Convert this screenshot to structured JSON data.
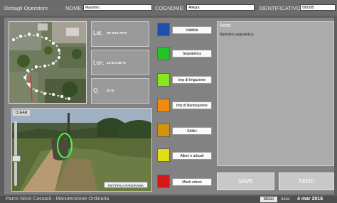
{
  "header": {
    "title": "Dettagli Operatore",
    "nome_label": "NOME:",
    "nome_value": "Massimo",
    "cognome_label": "COGNOME:",
    "cognome_value": "Allegra",
    "id_label": "IDENTIFICATIVO:",
    "id_value": "590395"
  },
  "coordinates": {
    "lat_label": "Lat.",
    "lat_value": "38° 8'57.79\"N",
    "lon_label": "Lon.",
    "lon_value": "13°20'3.60\"E",
    "q_label": "Q.",
    "q_value": "40 m"
  },
  "photo": {
    "clear_label": "CLEAR",
    "rettifica_label": "RETTIFICA PANORAMA"
  },
  "categories": [
    {
      "label": "Viabilità",
      "color": "#1f4fae"
    },
    {
      "label": "Segnaletica",
      "color": "#26c22a"
    },
    {
      "label": "Imp di Irrigazione",
      "color": "#86e81e"
    },
    {
      "label": "Imp di illuminazione",
      "color": "#f08b10"
    },
    {
      "label": "Edifici",
      "color": "#d39309"
    },
    {
      "label": "Alberi e arbusti",
      "color": "#e0dd12"
    },
    {
      "label": "Manti erbosi",
      "color": "#d41818"
    }
  ],
  "notes": {
    "label": "Note:",
    "text": "Ripristino segnaletica"
  },
  "actions": {
    "save_label": "SAVE",
    "send_label": "SEND"
  },
  "footer": {
    "title": "Parco Ninni Cassarà - Manutenzione Ordinaria",
    "menu_label": "MENU",
    "data_label": "data:",
    "date_value": "4 mar 2016"
  }
}
